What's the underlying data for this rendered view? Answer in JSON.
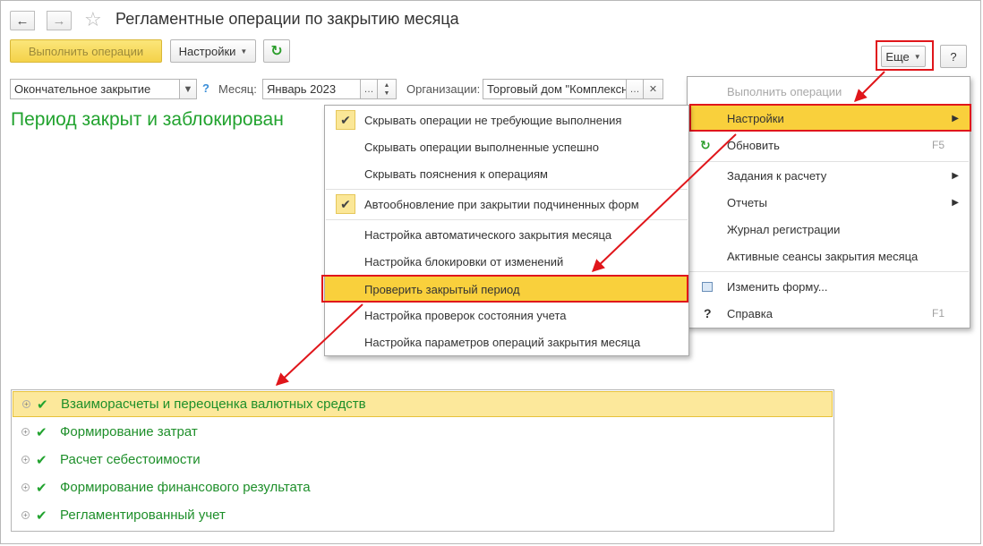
{
  "window": {
    "title": "Регламентные операции по закрытию месяца"
  },
  "toolbar": {
    "run_label": "Выполнить операции",
    "settings_label": "Настройки",
    "more_label": "Еще",
    "help_label": "?"
  },
  "filters": {
    "closing_type": "Окончательное закрытие",
    "help_mark": "?",
    "month_label": "Месяц:",
    "month_value": "Январь 2023",
    "org_label": "Организации:",
    "org_value": "Торговый дом \"Комплексный\""
  },
  "status": "Период закрыт и заблокирован",
  "settings_menu": {
    "items": [
      {
        "label": "Скрывать операции не требующие выполнения",
        "checked": true
      },
      {
        "label": "Скрывать операции выполненные успешно",
        "checked": false
      },
      {
        "label": "Скрывать пояснения к операциям",
        "checked": false
      },
      {
        "label": "Автообновление при закрытии подчиненных форм",
        "checked": true
      },
      {
        "label": "Настройка автоматического закрытия месяца"
      },
      {
        "label": "Настройка блокировки от изменений"
      },
      {
        "label": "Проверить закрытый период",
        "highlighted": true
      },
      {
        "label": "Настройка проверок состояния учета"
      },
      {
        "label": "Настройка параметров операций закрытия месяца"
      }
    ]
  },
  "more_menu": {
    "items": [
      {
        "label": "Выполнить операции",
        "disabled": true
      },
      {
        "label": "Настройки",
        "highlighted": true,
        "submenu": true
      },
      {
        "label": "Обновить",
        "shortcut": "F5",
        "icon": "refresh-icon"
      },
      {
        "label": "Задания к расчету",
        "submenu": true
      },
      {
        "label": "Отчеты",
        "submenu": true
      },
      {
        "label": "Журнал регистрации"
      },
      {
        "label": "Активные сеансы закрытия месяца"
      },
      {
        "label": "Изменить форму...",
        "icon": "form-icon"
      },
      {
        "label": "Справка",
        "shortcut": "F1",
        "icon": "help-icon"
      }
    ]
  },
  "operations": [
    {
      "label": "Взаиморасчеты и переоценка валютных средств",
      "done": true,
      "selected": true
    },
    {
      "label": "Формирование затрат",
      "done": true
    },
    {
      "label": "Расчет себестоимости",
      "done": true
    },
    {
      "label": "Формирование финансового результата",
      "done": true
    },
    {
      "label": "Регламентированный учет",
      "done": true
    }
  ],
  "colors": {
    "accent_yellow": "#f9d03c",
    "status_green": "#22a32f",
    "annotation_red": "#e0161b"
  }
}
